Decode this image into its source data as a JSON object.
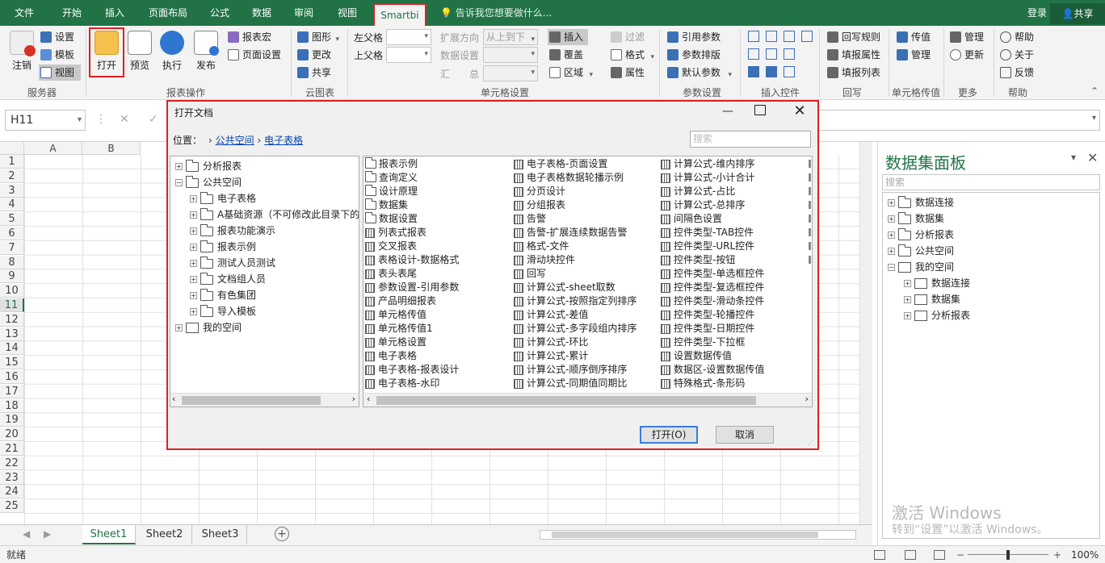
{
  "tabs": [
    "文件",
    "开始",
    "插入",
    "页面布局",
    "公式",
    "数据",
    "审阅",
    "视图",
    "Smartbi"
  ],
  "tell_me": "告诉我您想要做什么...",
  "login": "登录",
  "share": "共享",
  "ribbon": {
    "server": {
      "logout": "注销",
      "settings": "设置",
      "template": "模板",
      "view": "视图",
      "label": "服务器"
    },
    "report_ops": {
      "open": "打开",
      "preview": "预览",
      "execute": "执行",
      "publish": "发布",
      "macro": "报表宏",
      "page_setup": "页面设置",
      "label": "报表操作"
    },
    "cloud_chart": {
      "chart": "图形",
      "change": "更改",
      "share": "共享",
      "label": "云图表"
    },
    "cell_settings": {
      "left_parent": "左父格",
      "top_parent": "上父格",
      "expand_dir": "扩展方向",
      "expand_dir_value": "从上到下",
      "data_settings": "数据设置",
      "summary": "汇　　总",
      "insert": "插入",
      "overwrite": "覆盖",
      "area": "区域",
      "filter": "过滤",
      "format": "格式",
      "attr": "属性",
      "label": "单元格设置"
    },
    "params": {
      "ref": "引用参数",
      "layout": "参数排版",
      "default": "默认参数",
      "label": "参数设置"
    },
    "insert_controls": {
      "label": "插入控件"
    },
    "writeback": {
      "rules": "回写规则",
      "fill_attr": "填报属性",
      "fill_list": "填报列表",
      "label": "回写"
    },
    "cell_pass": {
      "pass": "传值",
      "manage": "管理",
      "label": "单元格传值"
    },
    "more": {
      "manage": "管理",
      "update": "更新",
      "label": "更多"
    },
    "help": {
      "help": "帮助",
      "about": "关于",
      "feedback": "反馈",
      "label": "帮助"
    }
  },
  "namebox": "H11",
  "columns": [
    "A",
    "B"
  ],
  "rows": [
    "1",
    "2",
    "3",
    "4",
    "5",
    "6",
    "7",
    "8",
    "9",
    "10",
    "11",
    "12",
    "13",
    "14",
    "15",
    "16",
    "17",
    "18",
    "19",
    "20",
    "21",
    "22",
    "23",
    "24",
    "25"
  ],
  "active_row": "11",
  "sheets": [
    "Sheet1",
    "Sheet2",
    "Sheet3"
  ],
  "status": "就绪",
  "zoom": "100%",
  "panel": {
    "title": "数据集面板",
    "search": "搜索",
    "tree": [
      {
        "label": "数据连接",
        "level": 0,
        "type": "folder"
      },
      {
        "label": "数据集",
        "level": 0,
        "type": "folder"
      },
      {
        "label": "分析报表",
        "level": 0,
        "type": "folder"
      },
      {
        "label": "公共空间",
        "level": 0,
        "type": "folder"
      },
      {
        "label": "我的空间",
        "level": 0,
        "type": "my",
        "expanded": true
      },
      {
        "label": "数据连接",
        "level": 1,
        "type": "my"
      },
      {
        "label": "数据集",
        "level": 1,
        "type": "my"
      },
      {
        "label": "分析报表",
        "level": 1,
        "type": "my"
      }
    ],
    "watermark_title": "激活 Windows",
    "watermark_sub": "转到“设置”以激活 Windows。"
  },
  "dialog": {
    "title": "打开文档",
    "location_label": "位置：",
    "crumbs": [
      "公共空间",
      "电子表格"
    ],
    "search": "搜索",
    "tree": [
      {
        "label": "分析报表",
        "level": 0
      },
      {
        "label": "公共空间",
        "level": 0,
        "expanded": true
      },
      {
        "label": "电子表格",
        "level": 1
      },
      {
        "label": "A基础资源（不可修改此目录下的",
        "level": 1
      },
      {
        "label": "报表功能演示",
        "level": 1
      },
      {
        "label": "报表示例",
        "level": 1
      },
      {
        "label": "测试人员测试",
        "level": 1
      },
      {
        "label": "文档组人员",
        "level": 1
      },
      {
        "label": "有色集团",
        "level": 1
      },
      {
        "label": "导入模板",
        "level": 1
      },
      {
        "label": "我的空间",
        "level": 0,
        "type": "my"
      }
    ],
    "col1": [
      {
        "t": "报表示例",
        "f": 1
      },
      {
        "t": "查询定义",
        "f": 1
      },
      {
        "t": "设计原理",
        "f": 1
      },
      {
        "t": "数据集",
        "f": 1
      },
      {
        "t": "数据设置",
        "f": 1
      },
      {
        "t": "列表式报表"
      },
      {
        "t": "交叉报表"
      },
      {
        "t": "表格设计-数据格式"
      },
      {
        "t": "表头表尾"
      },
      {
        "t": "参数设置-引用参数"
      },
      {
        "t": "产品明细报表"
      },
      {
        "t": "单元格传值"
      },
      {
        "t": "单元格传值1"
      },
      {
        "t": "单元格设置"
      },
      {
        "t": "电子表格"
      },
      {
        "t": "电子表格-报表设计"
      },
      {
        "t": "电子表格-水印"
      }
    ],
    "col2": [
      "电子表格-页面设置",
      "电子表格数据轮播示例",
      "分页设计",
      "分组报表",
      "告警",
      "告警-扩展连续数据告警",
      "格式-文件",
      "滑动块控件",
      "回写",
      "计算公式-sheet取数",
      "计算公式-按照指定列排序",
      "计算公式-差值",
      "计算公式-多字段组内排序",
      "计算公式-环比",
      "计算公式-累计",
      "计算公式-顺序倒序排序",
      "计算公式-同期值同期比"
    ],
    "col3": [
      "计算公式-维内排序",
      "计算公式-小计合计",
      "计算公式-占比",
      "计算公式-总排序",
      "间隔色设置",
      "控件类型-TAB控件",
      "控件类型-URL控件",
      "控件类型-按钮",
      "控件类型-单选框控件",
      "控件类型-复选框控件",
      "控件类型-滑动条控件",
      "控件类型-轮播控件",
      "控件类型-日期控件",
      "控件类型-下拉框",
      "设置数据传值",
      "数据区-设置数据传值",
      "特殊格式-条形码"
    ],
    "open_btn": "打开(O)",
    "cancel_btn": "取消"
  }
}
